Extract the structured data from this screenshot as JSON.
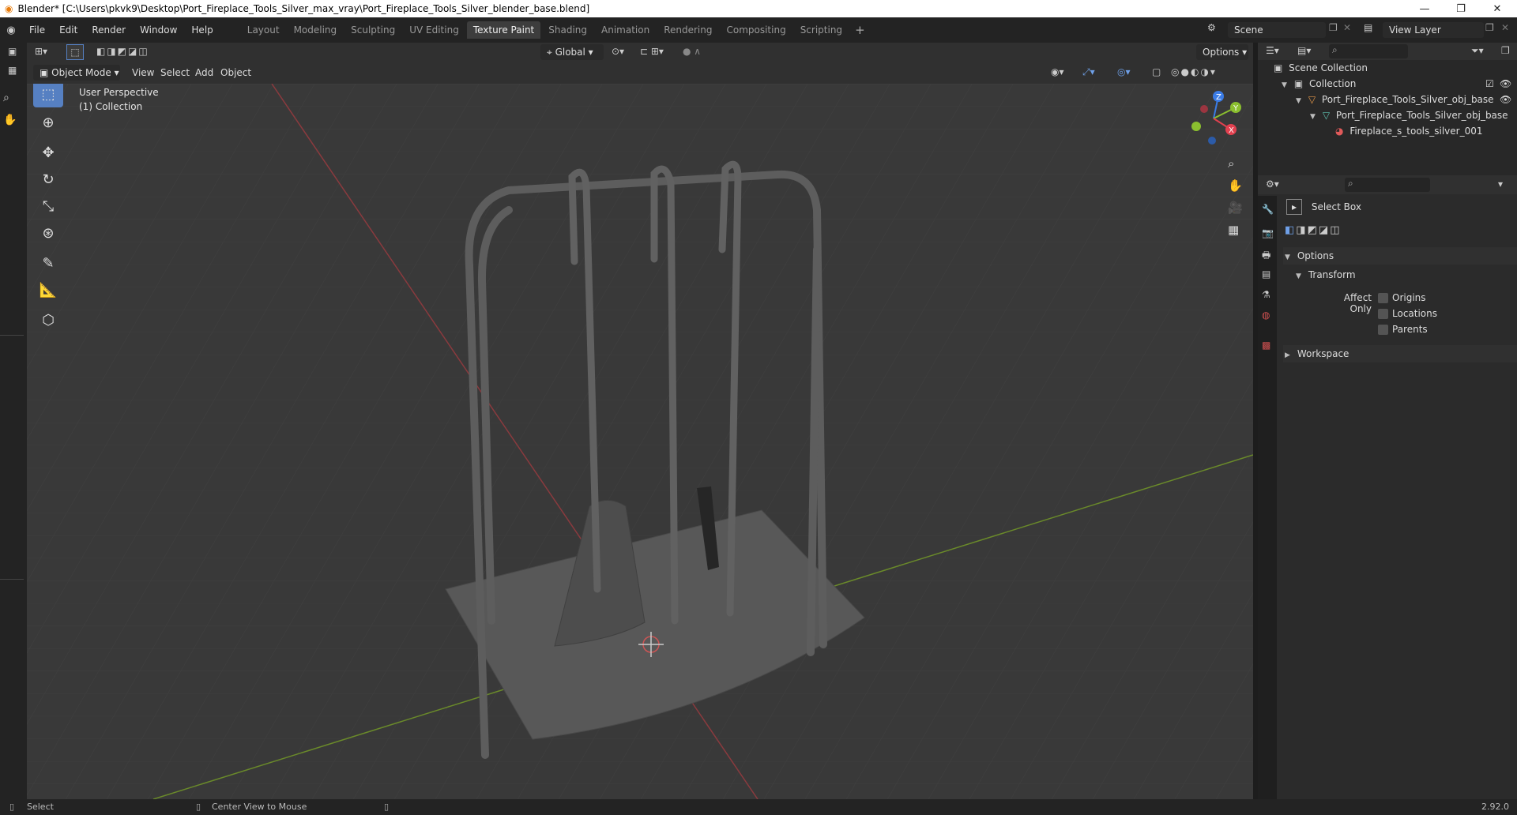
{
  "window": {
    "title": "Blender* [C:\\Users\\pkvk9\\Desktop\\Port_Fireplace_Tools_Silver_max_vray\\Port_Fireplace_Tools_Silver_blender_base.blend]"
  },
  "menu": [
    "File",
    "Edit",
    "Render",
    "Window",
    "Help"
  ],
  "workspaces": {
    "tabs": [
      "Layout",
      "Modeling",
      "Sculpting",
      "UV Editing",
      "Texture Paint",
      "Shading",
      "Animation",
      "Rendering",
      "Compositing",
      "Scripting"
    ],
    "active": "Texture Paint"
  },
  "scene": {
    "name": "Scene"
  },
  "view_layer": {
    "name": "View Layer"
  },
  "viewport_header": {
    "mode": "Object Mode",
    "menus": [
      "View",
      "Select",
      "Add",
      "Object"
    ],
    "orientation": "Global",
    "options_label": "Options"
  },
  "viewport": {
    "perspective": "User Perspective",
    "collection": "(1) Collection"
  },
  "outliner": {
    "root": "Scene Collection",
    "collection": "Collection",
    "object": "Port_Fireplace_Tools_Silver_obj_base",
    "mesh": "Port_Fireplace_Tools_Silver_obj_base",
    "material": "Fireplace_s_tools_silver_001"
  },
  "properties": {
    "tool_name": "Select Box",
    "options_label": "Options",
    "transform_label": "Transform",
    "affect_only_label": "Affect Only",
    "checks": [
      "Origins",
      "Locations",
      "Parents"
    ],
    "workspace_label": "Workspace"
  },
  "status": {
    "left_action": "Select",
    "mid_action": "Center View to Mouse",
    "version": "2.92.0"
  },
  "colors": {
    "accent": "#5680c2",
    "x_axis": "#e2404f",
    "y_axis": "#8bbf2f",
    "z_axis": "#3b7ce6"
  }
}
